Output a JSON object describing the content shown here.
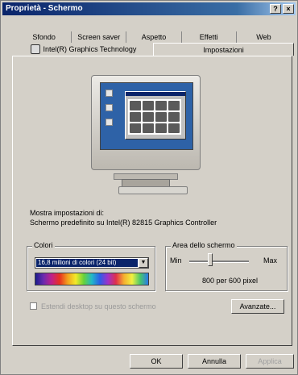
{
  "window": {
    "title": "Proprietà - Schermo",
    "help_btn": "?",
    "close_btn": "×"
  },
  "tabs_row1": [
    "Sfondo",
    "Screen saver",
    "Aspetto",
    "Effetti",
    "Web"
  ],
  "tabs_row2": {
    "intel": "Intel(R) Graphics Technology",
    "settings": "Impostazioni"
  },
  "display_info": {
    "label": "Mostra impostazioni di:",
    "device": "Schermo predefinito su Intel(R) 82815 Graphics Controller"
  },
  "colors": {
    "title": "Colori",
    "selected": "16,8 milioni di colori (24 bit)",
    "arrow": "▼"
  },
  "screen_area": {
    "title": "Area dello schermo",
    "min": "Min",
    "max": "Max",
    "resolution": "800 per 600 pixel",
    "slider_level": 0.35
  },
  "extend_checkbox": "Estendi desktop su questo schermo",
  "advanced_button": "Avanzate...",
  "bottom_buttons": {
    "ok": "OK",
    "cancel": "Annulla",
    "apply": "Applica"
  }
}
